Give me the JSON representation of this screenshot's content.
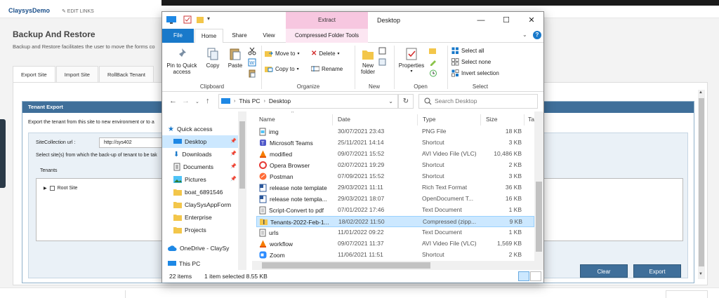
{
  "webapp": {
    "brand": "ClaysysDemo",
    "edit_links": "✎ EDIT LINKS",
    "page_title": "Backup And Restore",
    "page_desc": "Backup and Restore facilitates the user to move the forms co",
    "tabs": [
      "Export Site",
      "Import Site",
      "RollBack Tenant"
    ],
    "panel_title": "Tenant Export",
    "panel_desc": "Export the tenant from this site to new environment or to a",
    "site_collection_label": "SiteCollection url :",
    "site_collection_value": "http://sys402",
    "select_sites_label": "Select site(s) from which the back-up of tenant to be tak",
    "tenants_label": "Tenants",
    "root_site_label": "Root Site",
    "clear_button": "Clear",
    "export_button": "Export"
  },
  "explorer": {
    "title": "Desktop",
    "contextual_tab_group": "Extract",
    "ribbon_tabs": [
      "File",
      "Home",
      "Share",
      "View",
      "Compressed Folder Tools"
    ],
    "clipboard": {
      "pin_label": "Pin to Quick access",
      "copy_label": "Copy",
      "paste_label": "Paste",
      "group_label": "Clipboard"
    },
    "organize": {
      "move_to": "Move to",
      "copy_to": "Copy to",
      "delete": "Delete",
      "rename": "Rename",
      "group_label": "Organize"
    },
    "new": {
      "new_folder": "New folder",
      "group_label": "New"
    },
    "open": {
      "properties": "Properties",
      "group_label": "Open"
    },
    "select": {
      "select_all": "Select all",
      "select_none": "Select none",
      "invert_selection": "Invert selection",
      "group_label": "Select"
    },
    "address": {
      "root": "This PC",
      "current": "Desktop"
    },
    "search_placeholder": "Search Desktop",
    "nav_items": [
      {
        "label": "Quick access",
        "icon": "star-icon"
      },
      {
        "label": "Desktop",
        "icon": "desktop-icon"
      },
      {
        "label": "Downloads",
        "icon": "download-icon"
      },
      {
        "label": "Documents",
        "icon": "documents-icon"
      },
      {
        "label": "Pictures",
        "icon": "pictures-icon"
      },
      {
        "label": "boat_6891546",
        "icon": "folder-icon"
      },
      {
        "label": "ClaySysAppForm",
        "icon": "folder-icon"
      },
      {
        "label": "Enterprise",
        "icon": "folder-icon"
      },
      {
        "label": "Projects",
        "icon": "folder-icon"
      },
      {
        "label": "OneDrive - ClaySy",
        "icon": "cloud-icon"
      },
      {
        "label": "This PC",
        "icon": "pc-icon"
      }
    ],
    "columns": [
      "Name",
      "Date",
      "Type",
      "Size",
      "Ta"
    ],
    "files": [
      {
        "name": "img",
        "date": "30/07/2021 23:43",
        "type": "PNG File",
        "size": "18 KB",
        "icon": "image-file-icon"
      },
      {
        "name": "Microsoft Teams",
        "date": "25/11/2021 14:14",
        "type": "Shortcut",
        "size": "3 KB",
        "icon": "teams-icon"
      },
      {
        "name": "modified",
        "date": "09/07/2021 15:52",
        "type": "AVI Video File (VLC)",
        "size": "10,486 KB",
        "icon": "vlc-icon"
      },
      {
        "name": "Opera Browser",
        "date": "02/07/2021 19:29",
        "type": "Shortcut",
        "size": "2 KB",
        "icon": "opera-icon"
      },
      {
        "name": "Postman",
        "date": "07/09/2021 15:52",
        "type": "Shortcut",
        "size": "3 KB",
        "icon": "postman-icon"
      },
      {
        "name": "release note template",
        "date": "29/03/2021 11:11",
        "type": "Rich Text Format",
        "size": "36 KB",
        "icon": "rtf-icon"
      },
      {
        "name": "release note templa...",
        "date": "29/03/2021 18:07",
        "type": "OpenDocument T...",
        "size": "16 KB",
        "icon": "odt-icon"
      },
      {
        "name": "Script-Convert to pdf",
        "date": "07/01/2022 17:46",
        "type": "Text Document",
        "size": "1 KB",
        "icon": "text-file-icon"
      },
      {
        "name": "Tenants-2022-Feb-1...",
        "date": "18/02/2022 11:50",
        "type": "Compressed (zipp...",
        "size": "9 KB",
        "icon": "zip-folder-icon",
        "selected": true
      },
      {
        "name": "urls",
        "date": "11/01/2022 09:22",
        "type": "Text Document",
        "size": "1 KB",
        "icon": "text-file-icon"
      },
      {
        "name": "workflow",
        "date": "09/07/2021 11:37",
        "type": "AVI Video File (VLC)",
        "size": "1,569 KB",
        "icon": "vlc-icon"
      },
      {
        "name": "Zoom",
        "date": "11/06/2021 11:51",
        "type": "Shortcut",
        "size": "2 KB",
        "icon": "zoom-icon"
      }
    ],
    "status": {
      "item_count": "22 items",
      "selection": "1 item selected  8.55 KB"
    }
  }
}
